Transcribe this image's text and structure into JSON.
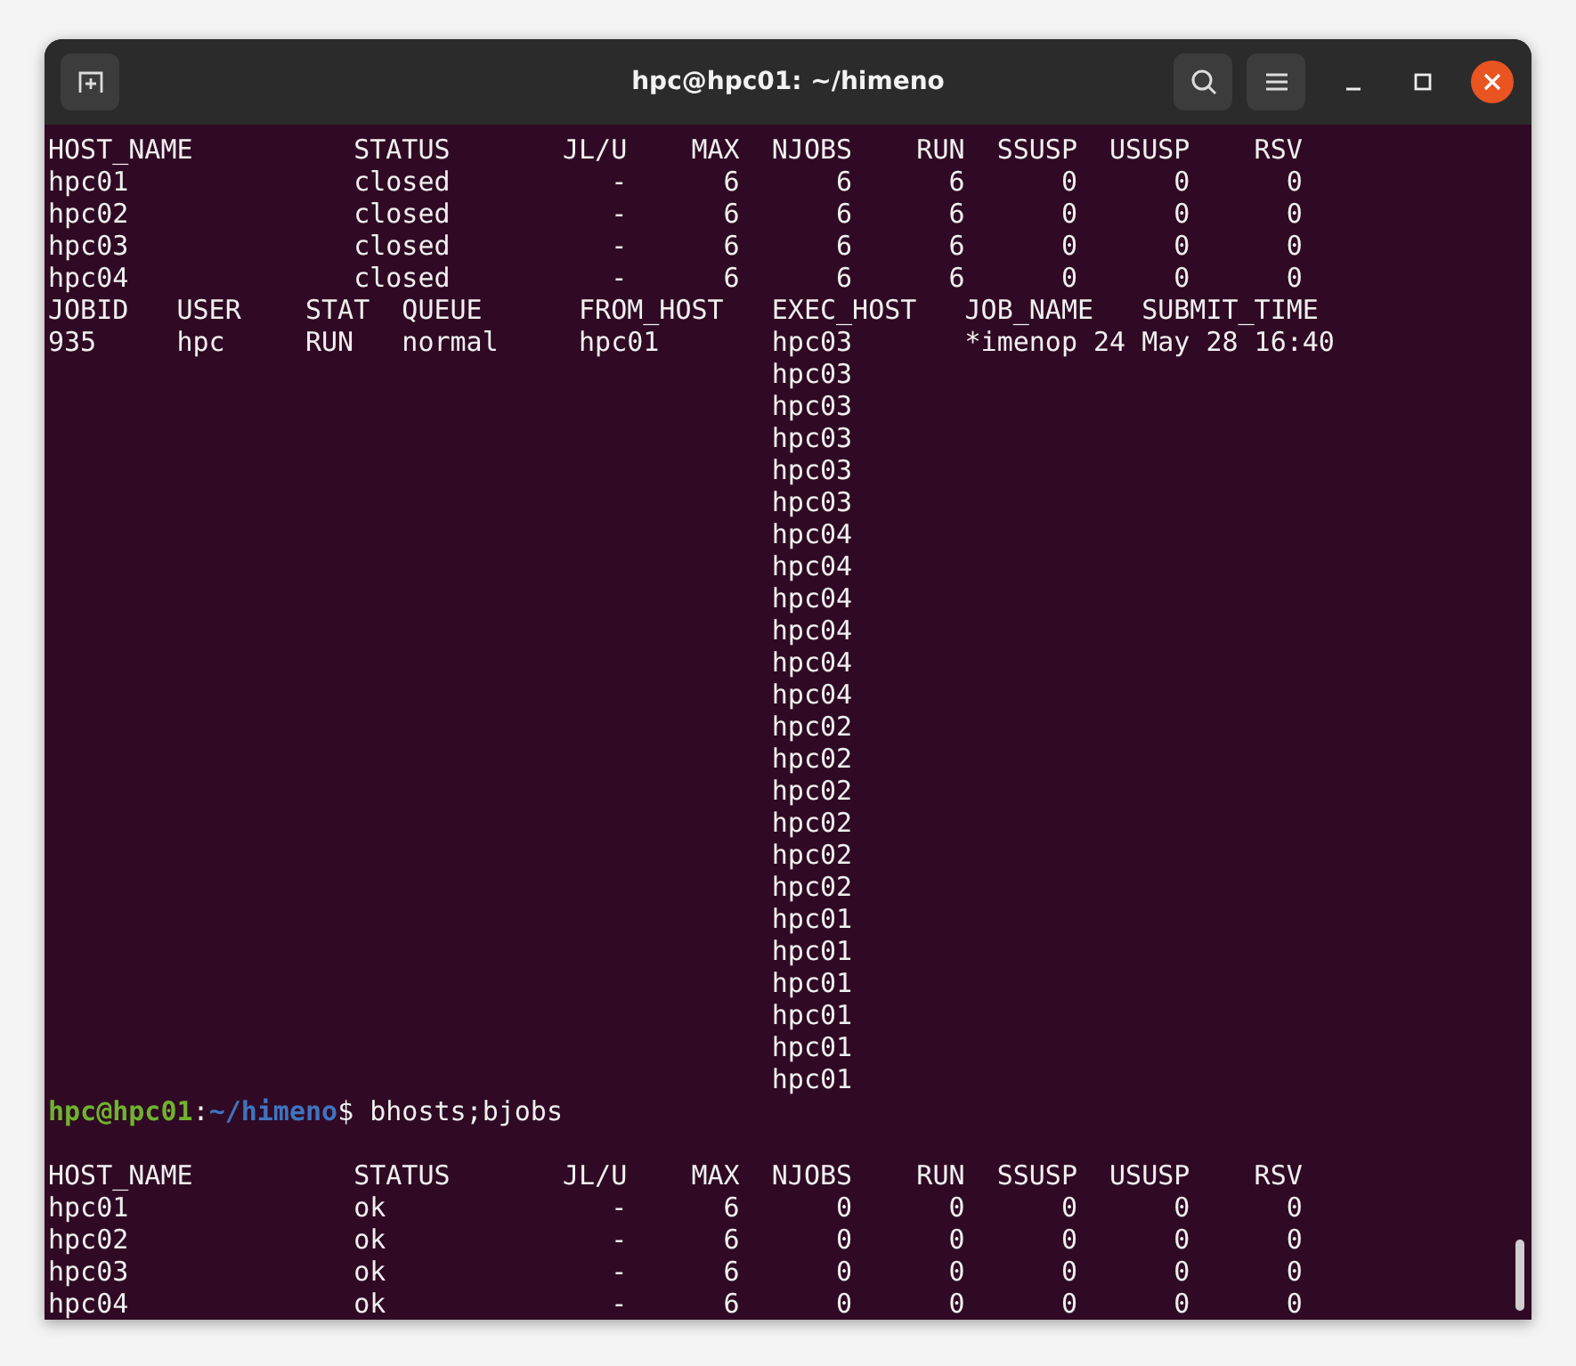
{
  "window": {
    "title": "hpc@hpc01: ~/himeno"
  },
  "terminal": {
    "lines": [
      {
        "kind": "output",
        "text": "HOST_NAME          STATUS       JL/U    MAX  NJOBS    RUN  SSUSP  USUSP    RSV"
      },
      {
        "kind": "output",
        "text": "hpc01              closed          -      6      6      6      0      0      0"
      },
      {
        "kind": "output",
        "text": "hpc02              closed          -      6      6      6      0      0      0"
      },
      {
        "kind": "output",
        "text": "hpc03              closed          -      6      6      6      0      0      0"
      },
      {
        "kind": "output",
        "text": "hpc04              closed          -      6      6      6      0      0      0"
      },
      {
        "kind": "output",
        "text": "JOBID   USER    STAT  QUEUE      FROM_HOST   EXEC_HOST   JOB_NAME   SUBMIT_TIME"
      },
      {
        "kind": "output",
        "text": "935     hpc     RUN   normal     hpc01       hpc03       *imenop 24 May 28 16:40"
      },
      {
        "kind": "output",
        "text": "                                             hpc03"
      },
      {
        "kind": "output",
        "text": "                                             hpc03"
      },
      {
        "kind": "output",
        "text": "                                             hpc03"
      },
      {
        "kind": "output",
        "text": "                                             hpc03"
      },
      {
        "kind": "output",
        "text": "                                             hpc03"
      },
      {
        "kind": "output",
        "text": "                                             hpc04"
      },
      {
        "kind": "output",
        "text": "                                             hpc04"
      },
      {
        "kind": "output",
        "text": "                                             hpc04"
      },
      {
        "kind": "output",
        "text": "                                             hpc04"
      },
      {
        "kind": "output",
        "text": "                                             hpc04"
      },
      {
        "kind": "output",
        "text": "                                             hpc04"
      },
      {
        "kind": "output",
        "text": "                                             hpc02"
      },
      {
        "kind": "output",
        "text": "                                             hpc02"
      },
      {
        "kind": "output",
        "text": "                                             hpc02"
      },
      {
        "kind": "output",
        "text": "                                             hpc02"
      },
      {
        "kind": "output",
        "text": "                                             hpc02"
      },
      {
        "kind": "output",
        "text": "                                             hpc02"
      },
      {
        "kind": "output",
        "text": "                                             hpc01"
      },
      {
        "kind": "output",
        "text": "                                             hpc01"
      },
      {
        "kind": "output",
        "text": "                                             hpc01"
      },
      {
        "kind": "output",
        "text": "                                             hpc01"
      },
      {
        "kind": "output",
        "text": "                                             hpc01"
      },
      {
        "kind": "output",
        "text": "                                             hpc01"
      },
      {
        "kind": "prompt",
        "user_host": "hpc@hpc01",
        "separator": ":",
        "path": "~/himeno",
        "symbol": "$",
        "command": "bhosts;bjobs"
      },
      {
        "kind": "blank"
      },
      {
        "kind": "output",
        "text": "HOST_NAME          STATUS       JL/U    MAX  NJOBS    RUN  SSUSP  USUSP    RSV"
      },
      {
        "kind": "output",
        "text": "hpc01              ok              -      6      0      0      0      0      0"
      },
      {
        "kind": "output",
        "text": "hpc02              ok              -      6      0      0      0      0      0"
      },
      {
        "kind": "output",
        "text": "hpc03              ok              -      6      0      0      0      0      0"
      },
      {
        "kind": "output",
        "text": "hpc04              ok              -      6      0      0      0      0      0"
      }
    ]
  }
}
